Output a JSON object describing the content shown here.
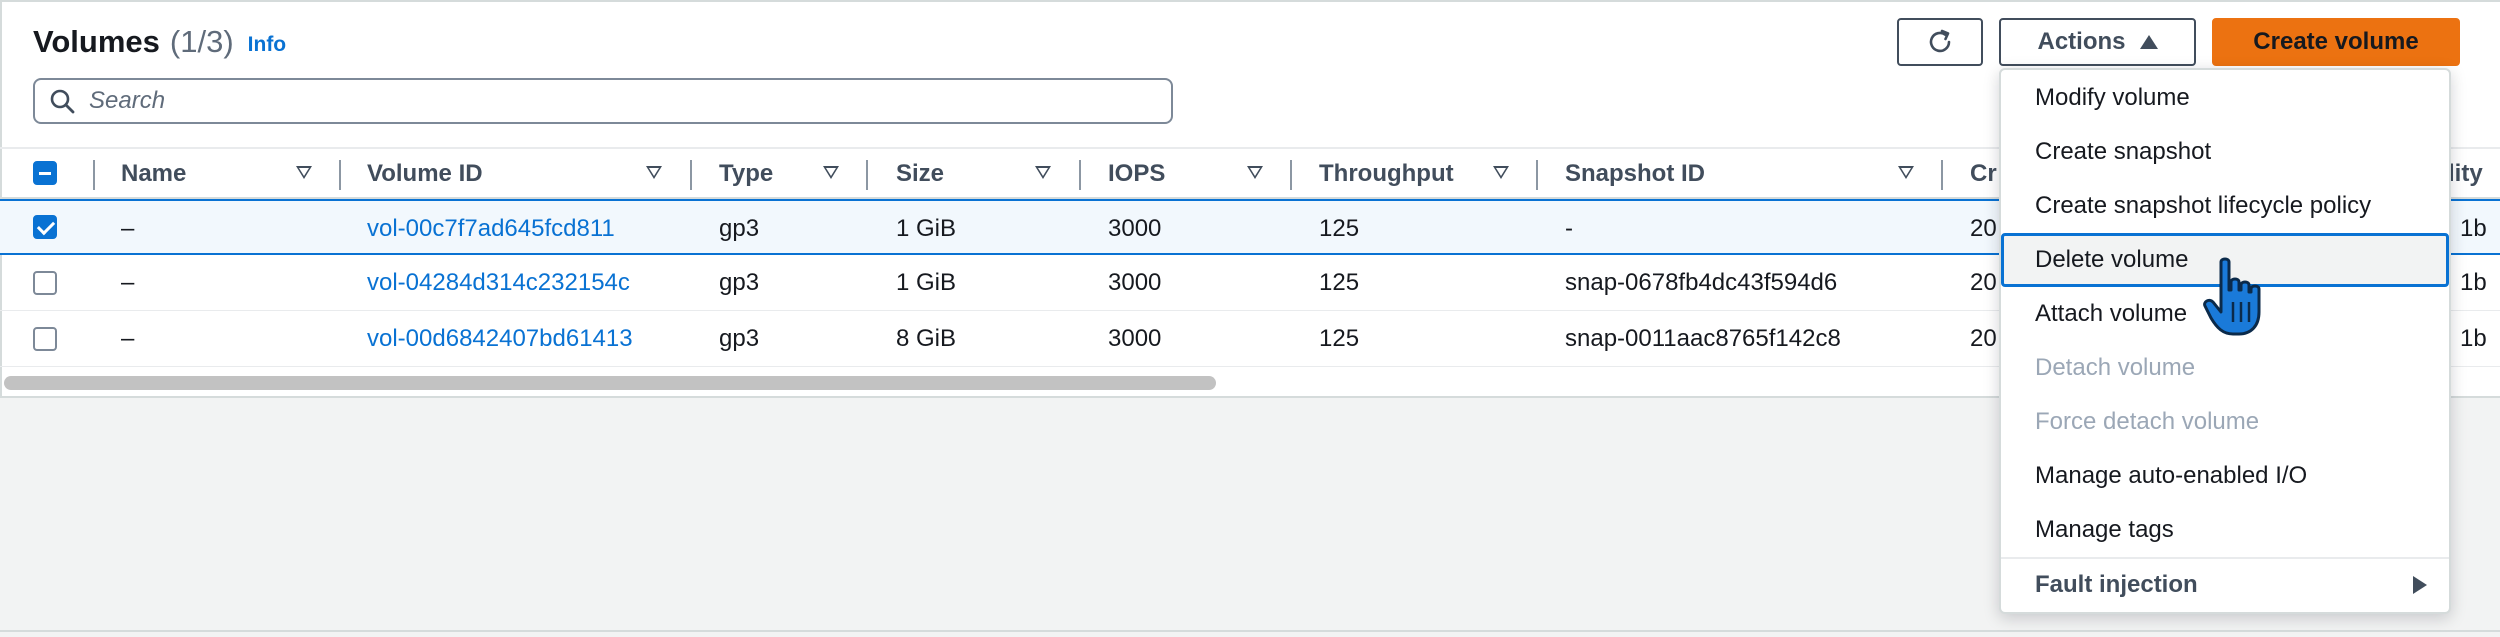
{
  "header": {
    "title": "Volumes",
    "count": "(1/3)",
    "info_link": "Info"
  },
  "search": {
    "placeholder": "Search"
  },
  "toolbar": {
    "refresh_icon": "refresh-icon",
    "actions_label": "Actions",
    "create_label": "Create volume"
  },
  "table": {
    "columns": [
      {
        "label": "Name"
      },
      {
        "label": "Volume ID"
      },
      {
        "label": "Type"
      },
      {
        "label": "Size"
      },
      {
        "label": "IOPS"
      },
      {
        "label": "Throughput"
      },
      {
        "label": "Snapshot ID"
      },
      {
        "label": "Cr"
      },
      {
        "label": "lity"
      }
    ],
    "rows": [
      {
        "name": "–",
        "volume_id": "vol-00c7f7ad645fcd811",
        "type": "gp3",
        "size": "1 GiB",
        "iops": "3000",
        "throughput": "125",
        "snapshot_id": "-",
        "created": "20",
        "az": "1b"
      },
      {
        "name": "–",
        "volume_id": "vol-04284d314c232154c",
        "type": "gp3",
        "size": "1 GiB",
        "iops": "3000",
        "throughput": "125",
        "snapshot_id": "snap-0678fb4dc43f594d6",
        "created": "20",
        "az": "1b"
      },
      {
        "name": "–",
        "volume_id": "vol-00d6842407bd61413",
        "type": "gp3",
        "size": "8 GiB",
        "iops": "3000",
        "throughput": "125",
        "snapshot_id": "snap-0011aac8765f142c8",
        "created": "20",
        "az": "1b"
      }
    ]
  },
  "actions_menu": {
    "items": [
      {
        "label": "Modify volume",
        "state": "enabled"
      },
      {
        "label": "Create snapshot",
        "state": "enabled"
      },
      {
        "label": "Create snapshot lifecycle policy",
        "state": "enabled"
      },
      {
        "label": "Delete volume",
        "state": "hovered"
      },
      {
        "label": "Attach volume",
        "state": "enabled"
      },
      {
        "label": "Detach volume",
        "state": "disabled"
      },
      {
        "label": "Force detach volume",
        "state": "disabled"
      },
      {
        "label": "Manage auto-enabled I/O",
        "state": "enabled"
      },
      {
        "label": "Manage tags",
        "state": "enabled"
      },
      {
        "label": "Fault injection",
        "state": "submenu"
      }
    ]
  },
  "colors": {
    "link": "#0972d3",
    "primary_button": "#ec7211",
    "selected_row": "#f2f8fd",
    "disabled_text": "#9ba7b6"
  }
}
